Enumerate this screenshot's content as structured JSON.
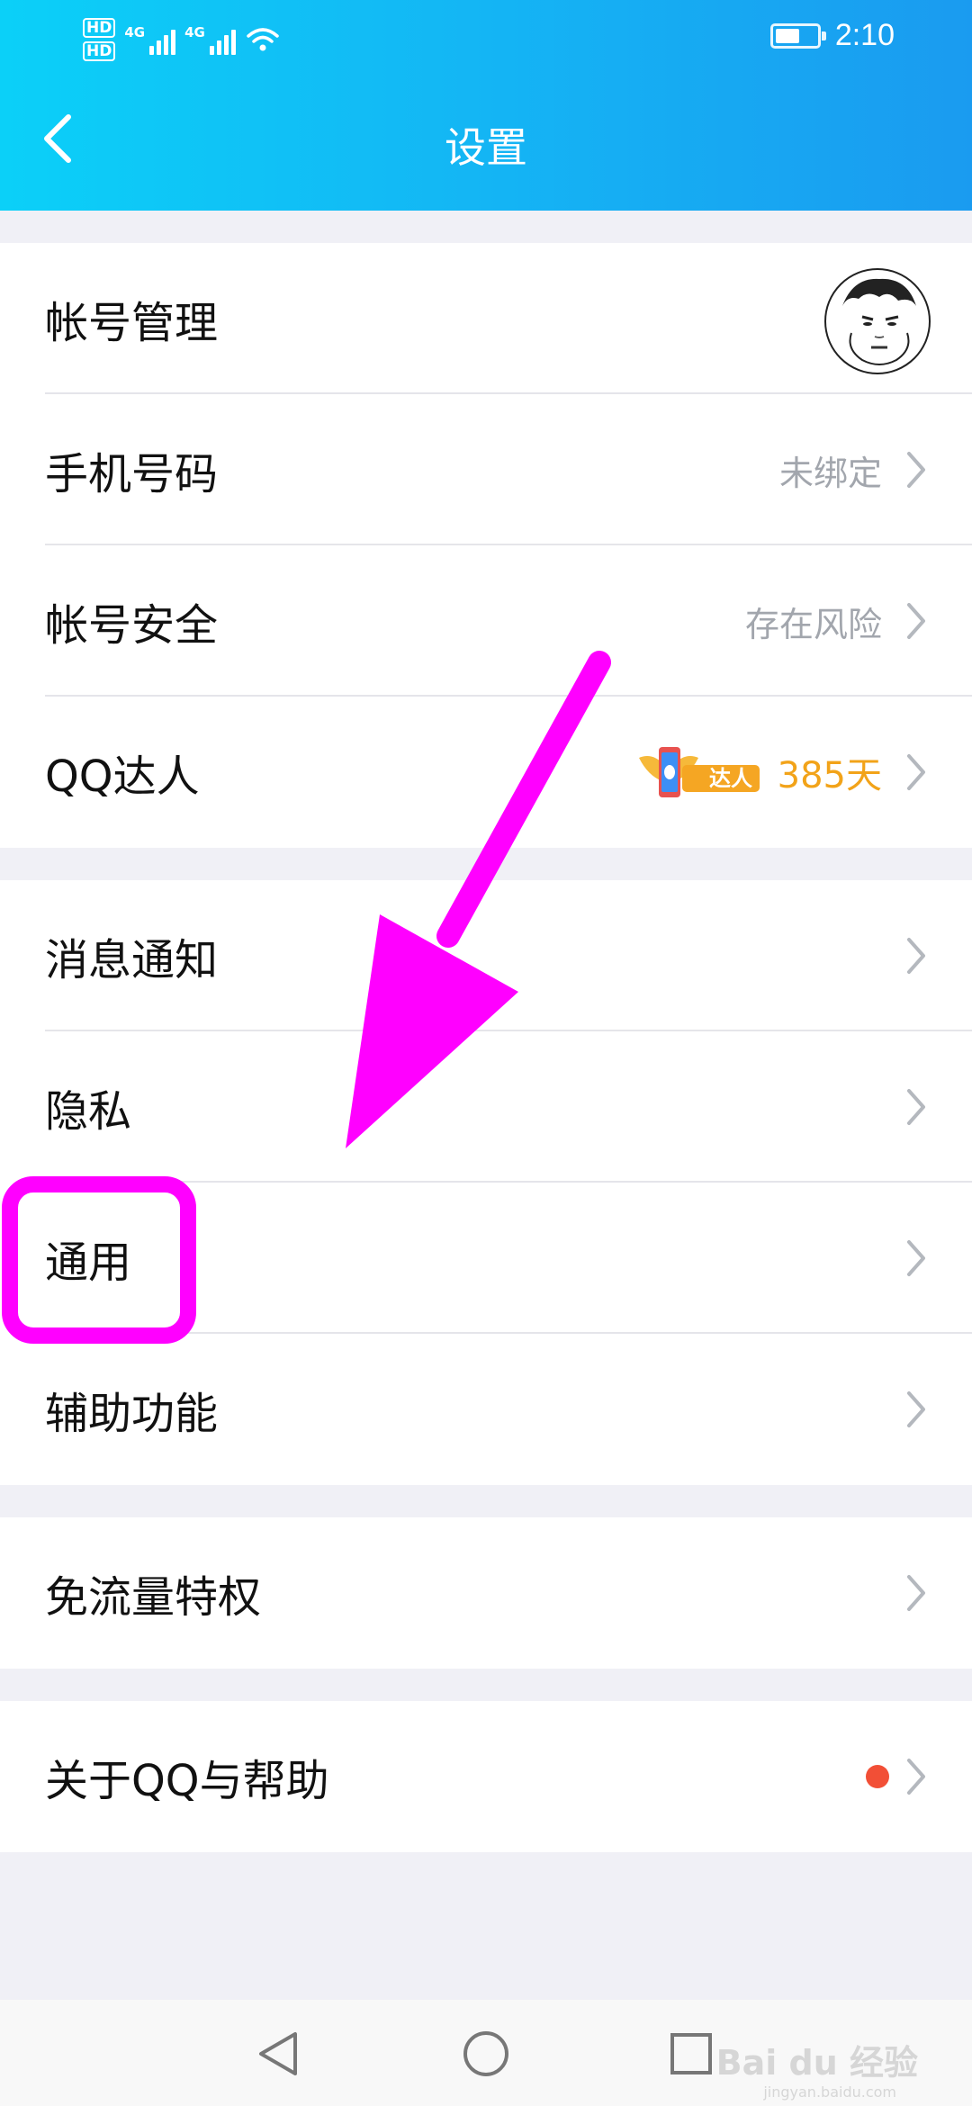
{
  "status_bar": {
    "hd1": "HD",
    "hd2": "HD",
    "net1": "4G",
    "net2": "4G",
    "time": "2:10",
    "battery_level": 0.6
  },
  "header": {
    "title": "设置",
    "back_icon": "chevron-left-icon"
  },
  "groups": [
    {
      "items": [
        {
          "label": "帐号管理",
          "value": "",
          "trailing": "avatar"
        },
        {
          "label": "手机号码",
          "value": "未绑定"
        },
        {
          "label": "帐号安全",
          "value": "存在风险"
        },
        {
          "label": "QQ达人",
          "value": "385天",
          "badge_text": "达人"
        }
      ]
    },
    {
      "items": [
        {
          "label": "消息通知"
        },
        {
          "label": "隐私"
        },
        {
          "label": "通用"
        },
        {
          "label": "辅助功能"
        }
      ]
    },
    {
      "items": [
        {
          "label": "免流量特权"
        }
      ]
    },
    {
      "items": [
        {
          "label": "关于QQ与帮助",
          "indicator": "red-dot"
        }
      ]
    }
  ],
  "colors": {
    "header_start": "#0bd0f8",
    "header_end": "#1a9bf0",
    "annotation": "#ff00ff",
    "daren_orange": "#f2a319",
    "red_dot": "#f24f36"
  },
  "watermark": {
    "text": "Bai du 经验",
    "sub": "jingyan.baidu.com"
  }
}
